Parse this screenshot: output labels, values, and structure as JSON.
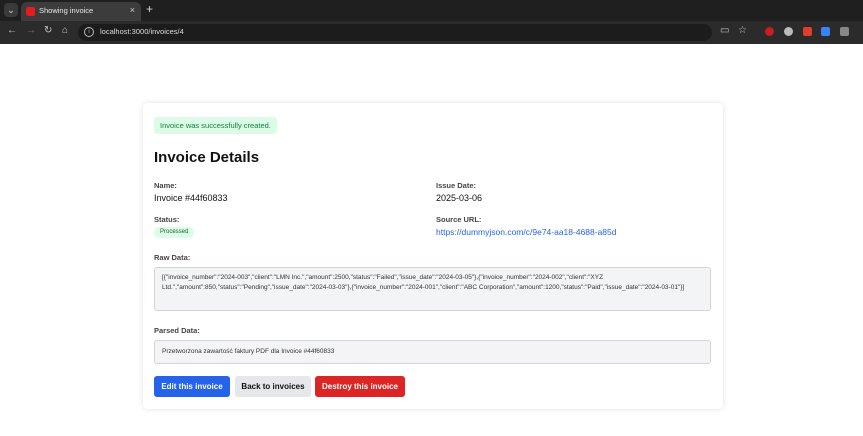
{
  "browser": {
    "tab_title": "Showing invoice",
    "tab_close": "×",
    "new_tab": "+",
    "menu_glyph": "⌄",
    "back_glyph": "←",
    "forward_glyph": "→",
    "reload_glyph": "↻",
    "home_glyph": "⌂",
    "url": "localhost:3000/invoices/4",
    "info_glyph": "i",
    "cast_glyph": "▭",
    "star_glyph": "☆"
  },
  "flash": "Invoice was successfully created.",
  "page_title": "Invoice Details",
  "fields": {
    "name_label": "Name:",
    "name_value": "Invoice #44f60833",
    "issue_date_label": "Issue Date:",
    "issue_date_value": "2025-03-06",
    "status_label": "Status:",
    "status_value": "Processed",
    "source_label": "Source URL:",
    "source_value": "https://dummyjson.com/c/9e74-aa18-4688-a85d",
    "raw_label": "Raw Data:",
    "raw_value": "[{\"invoice_number\":\"2024-003\",\"client\":\"LMN Inc.\",\"amount\":2500,\"status\":\"Failed\",\"issue_date\":\"2024-03-05\"},{\"invoice_number\":\"2024-002\",\"client\":\"XYZ Ltd.\",\"amount\":850,\"status\":\"Pending\",\"issue_date\":\"2024-03-03\"},{\"invoice_number\":\"2024-001\",\"client\":\"ABC Corporation\",\"amount\":1200,\"status\":\"Paid\",\"issue_date\":\"2024-03-01\"}]",
    "parsed_label": "Parsed Data:",
    "parsed_value": "Przetworzona zawartość faktury PDF dla Invoice #44f60833"
  },
  "actions": {
    "edit": "Edit this invoice",
    "back": "Back to invoices",
    "destroy": "Destroy this invoice"
  },
  "colors": {
    "primary": "#2563eb",
    "danger": "#dc2626",
    "success_bg": "#dcfce7",
    "success_text": "#15803d"
  }
}
